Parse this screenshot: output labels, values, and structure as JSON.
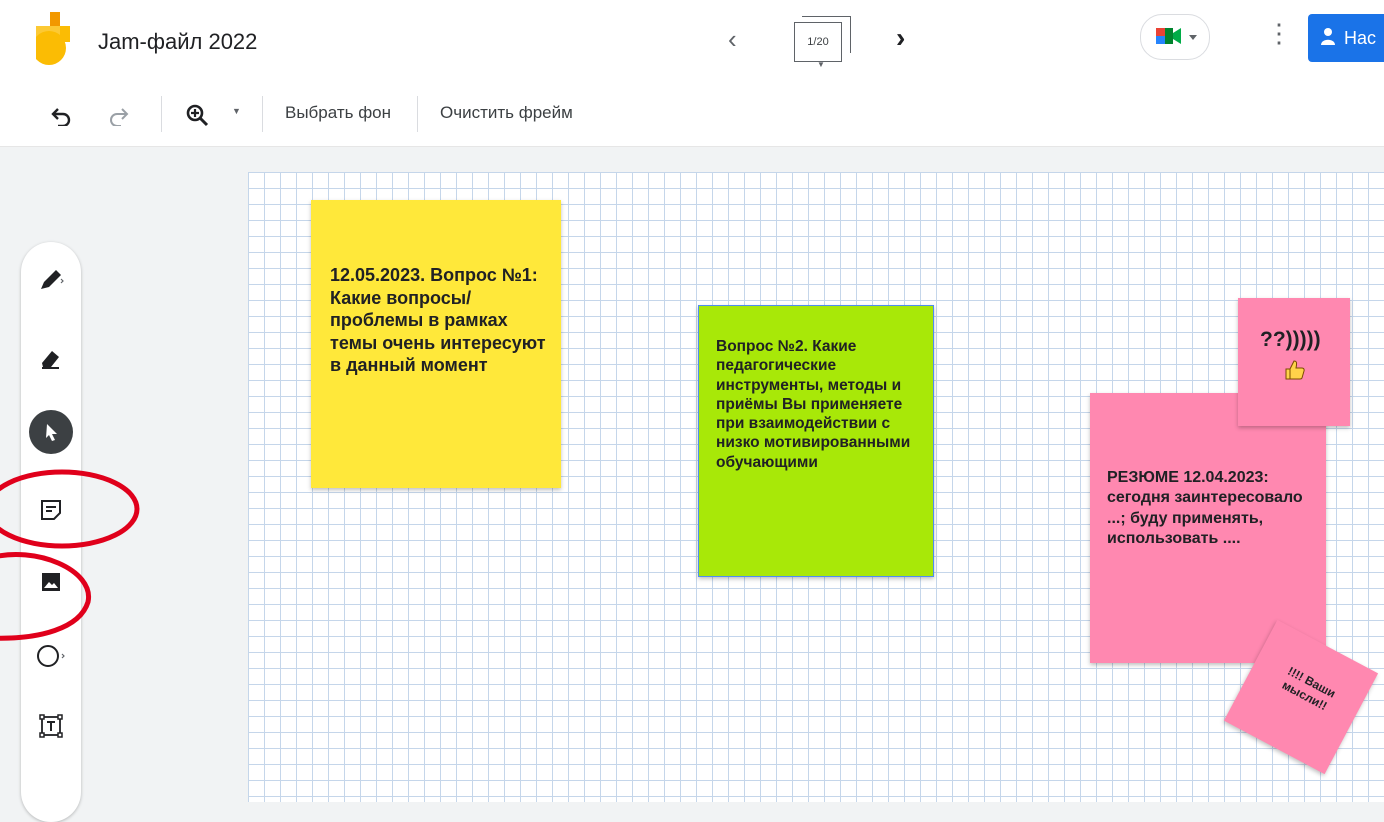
{
  "app": {
    "title": "Jam-файл 2022",
    "frame_counter": "1/20"
  },
  "header": {
    "share_label": "Нас"
  },
  "toolbar": {
    "set_background": "Выбрать фон",
    "clear_frame": "Очистить фрейм"
  },
  "notes": {
    "note1": "12.05.2023. Вопрос №1: Какие вопросы/проблемы в рамках темы очень интересуют в данный момент",
    "note2": "Вопрос №2. Какие педагогические инструменты, методы и приёмы Вы применяете при взаимодействии с низко мотивированными обучающими",
    "note3": "РЕЗЮМЕ 12.04.2023: сегодня заинтересовало ...; буду применять, использовать ....",
    "note4": "??)))))",
    "note5": "!!!! Ваши мысли!!"
  },
  "colors": {
    "yellow_note": "#ffe83a",
    "green_note": "#a8e808",
    "pink_note": "#ff88b0",
    "share_button": "#1a73e8",
    "annotation_circle": "#e0001b"
  },
  "icons": [
    "jamboard-logo-icon",
    "chevron-left-icon",
    "chevron-right-icon",
    "frames-icon",
    "google-meet-icon",
    "more-vert-icon",
    "person-add-icon",
    "undo-icon",
    "redo-icon",
    "zoom-in-icon",
    "dropdown-arrow-icon",
    "pen-icon",
    "eraser-icon",
    "pointer-icon",
    "sticky-note-icon",
    "image-icon",
    "circle-shape-icon",
    "text-box-icon",
    "thumbs-up-icon"
  ]
}
